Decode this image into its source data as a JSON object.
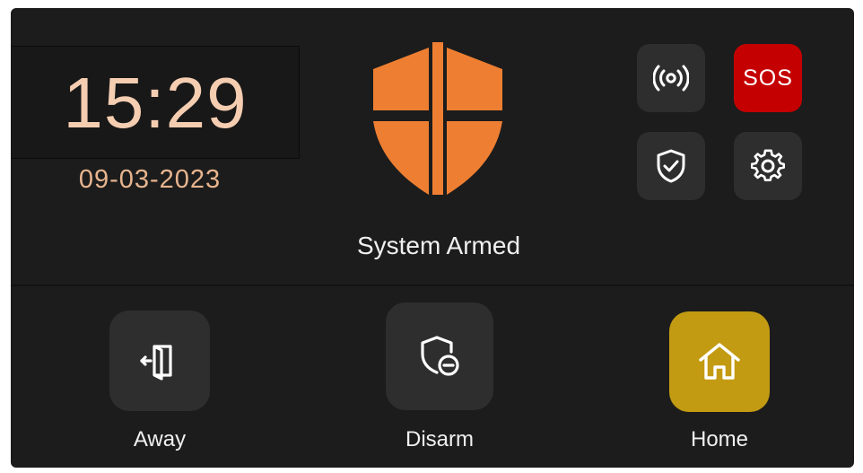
{
  "clock": {
    "time": "15:29",
    "date": "09-03-2023"
  },
  "status": {
    "text": "System Armed"
  },
  "quick_tiles": {
    "signal_icon": "wireless-signal-icon",
    "sos_label": "SOS",
    "shield_icon": "shield-check-icon",
    "settings_icon": "gear-icon"
  },
  "modes": {
    "away": {
      "label": "Away",
      "icon": "door-exit-icon"
    },
    "disarm": {
      "label": "Disarm",
      "icon": "shield-minus-icon"
    },
    "home": {
      "label": "Home",
      "icon": "house-icon",
      "active": true
    }
  },
  "colors": {
    "background": "#1c1c1c",
    "clock_time": "#f5cdb1",
    "clock_date": "#e7b48e",
    "shield": "#ee7f32",
    "sos": "#c50000",
    "active_mode": "#c39b12",
    "tile": "#2e2e2e"
  }
}
